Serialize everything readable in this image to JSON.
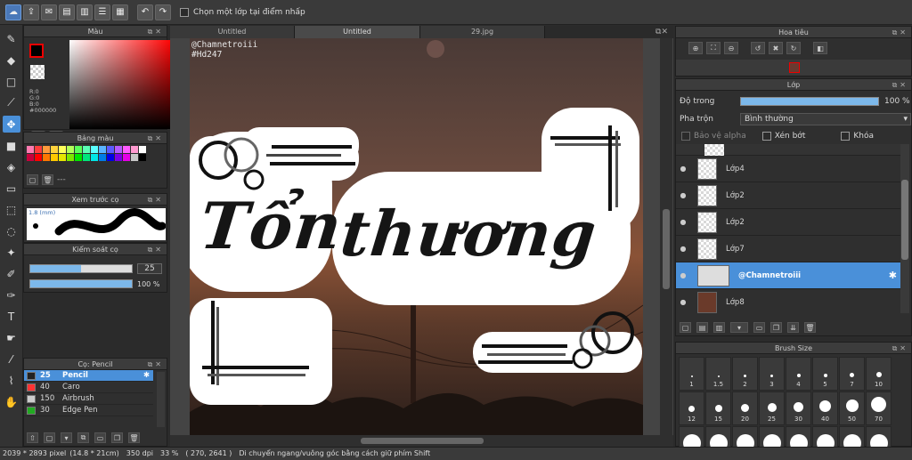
{
  "toolbar": {
    "select_label": "Chọn một lớp tại điểm nhấp"
  },
  "tabs": [
    "Untitled",
    "Untitled",
    "29.jpg"
  ],
  "color_panel": {
    "title": "Màu",
    "r": "R:0",
    "g": "G:0",
    "b": "B:0",
    "hex": "#000000"
  },
  "palette_panel": {
    "title": "Bảng màu",
    "extra": "---",
    "colors": [
      "#ff7bb1",
      "#ff3c3c",
      "#ff9a3c",
      "#ffd23c",
      "#ffff5a",
      "#b4ff5a",
      "#5aff5a",
      "#5affb4",
      "#5affff",
      "#5ab4ff",
      "#5a5aff",
      "#b45aff",
      "#ff5aff",
      "#ff9ad0",
      "#ffffff",
      "#c8003c",
      "#ff0000",
      "#ff7700",
      "#ffc800",
      "#e6e600",
      "#7ce600",
      "#00e600",
      "#00e67c",
      "#00e6e6",
      "#007ce6",
      "#0000e6",
      "#7c00e6",
      "#e600e6",
      "#c8c8c8",
      "#000000"
    ]
  },
  "preview_panel": {
    "title": "Xem trước cọ",
    "size": "1.8 (mm)"
  },
  "control_panel": {
    "title": "Kiểm soát cọ",
    "size_value": "25",
    "opacity_value": "100 %",
    "size_fraction": 0.5,
    "opacity_fraction": 1.0
  },
  "brush_panel": {
    "title": "Cọ: Pencil",
    "items": [
      {
        "size": "25",
        "name": "Pencil",
        "color": "#222222"
      },
      {
        "size": "40",
        "name": "Caro",
        "color": "#ff3333"
      },
      {
        "size": "150",
        "name": "Airbrush",
        "color": "#cccccc"
      },
      {
        "size": "30",
        "name": "Edge Pen",
        "color": "#22aa22"
      }
    ]
  },
  "artwork": {
    "watermark_line1": "@Chamnetroiii",
    "watermark_line2": "#Hd247",
    "word1": "Tổn",
    "word2": "thương"
  },
  "navigator_panel": {
    "title": "Hoa tiêu"
  },
  "layer_panel": {
    "title": "Lớp",
    "opacity_label": "Độ trong",
    "opacity_value": "100 %",
    "blend_label": "Pha trộn",
    "blend_value": "Bình thường",
    "protect_alpha": "Bảo vệ alpha",
    "clipping": "Xén bớt",
    "lock": "Khóa",
    "layers": [
      {
        "name": "Lớp4"
      },
      {
        "name": "Lớp2"
      },
      {
        "name": "Lớp2"
      },
      {
        "name": "Lớp7"
      },
      {
        "name": "@Chamnetroiii"
      },
      {
        "name": "Lớp8"
      }
    ]
  },
  "brushsize_panel": {
    "title": "Brush Size",
    "sizes": [
      "1",
      "1.5",
      "2",
      "3",
      "4",
      "5",
      "7",
      "10",
      "12",
      "15",
      "20",
      "25",
      "30",
      "40",
      "50",
      "70"
    ]
  },
  "status": {
    "dims": "2039 * 2893 pixel",
    "cm": "(14.8 * 21cm)",
    "dpi": "350 dpi",
    "zoom": "33 %",
    "coords": "( 270, 2641 )",
    "hint": "Di chuyển ngang/vuông góc bằng cách giữ phím Shift"
  }
}
